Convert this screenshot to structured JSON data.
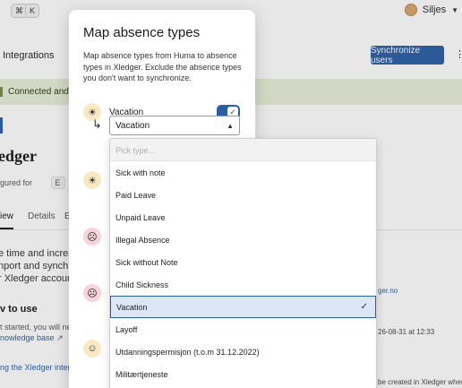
{
  "topbar": {
    "shortcut_keys": [
      "⌘",
      "K"
    ],
    "user_name": "Siljes"
  },
  "background": {
    "integrations_label": "Integrations",
    "sync_button": "Synchronize users",
    "more_button": "⋮",
    "connection_status": "Connected and ac",
    "page_title": "edger",
    "configured_text": "gured for",
    "configured_chip": "E",
    "tabs": [
      "iew",
      "Details",
      "E"
    ],
    "description_lines": [
      "e time and increa",
      "nport and synch",
      "r Xledger accoun"
    ],
    "how_title": "v to use",
    "started_text": "t started, you will nee",
    "kb_link": "nowledge base",
    "bottom_link": "ng the Xledger integr",
    "right_link": "ger.no",
    "right_date": "26-08-31 at 12:33",
    "right_text": "be created in Xledger when ac"
  },
  "modal": {
    "title": "Map absence types",
    "description": "Map absence types from Huma to absence types in Xledger. Exclude the absence types you don't want to synchronize.",
    "rows": [
      {
        "icon": "sun-icon",
        "label": "Vacation",
        "enabled": true
      },
      {
        "icon": "sun-icon"
      },
      {
        "icon": "sick-face-icon"
      },
      {
        "icon": "sick-face-icon"
      },
      {
        "icon": "smile-face-icon"
      }
    ],
    "mapping_select": {
      "value": "Vacation"
    }
  },
  "dropdown": {
    "placeholder": "Pick type...",
    "options": [
      "Sick with note",
      "Paid Leave",
      "Unpaid Leave",
      "Illegal Absence",
      "Sick without Note",
      "Child Sickness",
      "Vacation",
      "Layoff",
      "Utdanningspermisjon (t.o.m 31.12.2022)",
      "Militærtjeneste"
    ],
    "selected": "Vacation"
  },
  "colors": {
    "accent": "#2b5ea6",
    "banner": "#e8eed9",
    "sun_bg": "#fbe9c4",
    "sick_bg": "#f8d4d8",
    "selected_bg": "#dbe6f6"
  }
}
